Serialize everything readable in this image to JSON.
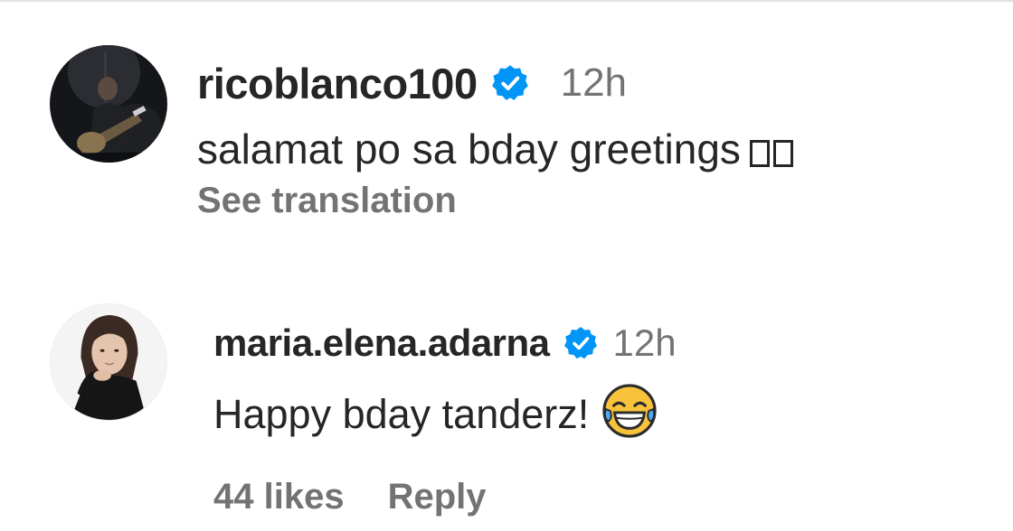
{
  "colors": {
    "text_primary": "#262626",
    "text_secondary": "#737373",
    "verified_blue": "#0095f6"
  },
  "comments": [
    {
      "avatar_icon": "profile-photo-guitarist",
      "username": "ricoblanco100",
      "verified_icon": "verified-badge-icon",
      "timestamp": "12h",
      "text": "salamat po sa bday greetings",
      "trailing_glyphs": "□□",
      "see_translation": "See translation"
    },
    {
      "avatar_icon": "profile-photo-woman",
      "username": "maria.elena.adarna",
      "verified_icon": "verified-badge-icon",
      "timestamp": "12h",
      "text": "Happy bday tanderz!",
      "emoji_icon": "face-with-tears-of-joy",
      "likes": "44 likes",
      "reply": "Reply"
    }
  ]
}
